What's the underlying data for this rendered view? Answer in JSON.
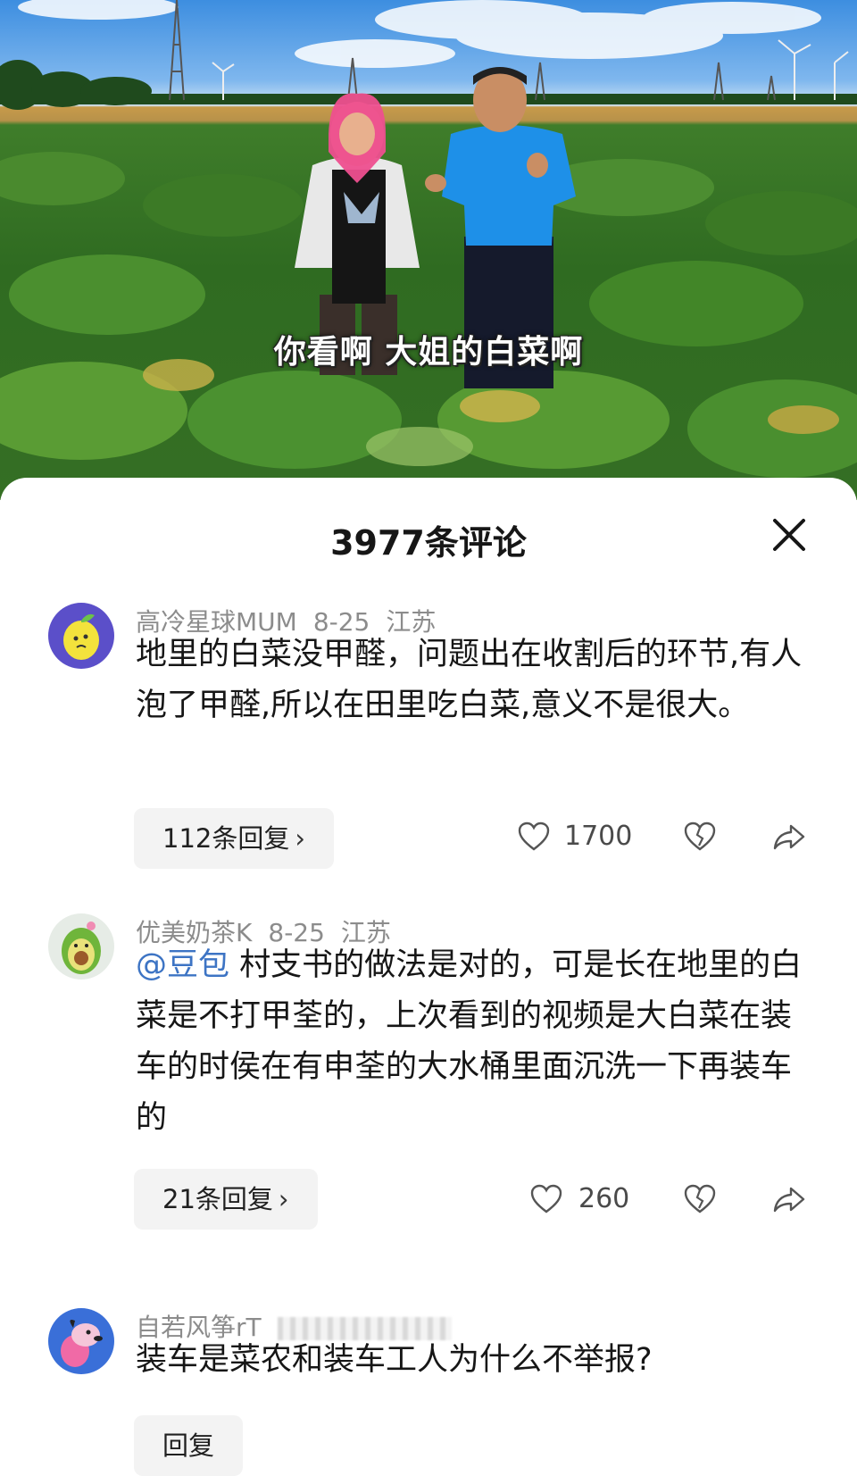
{
  "video": {
    "caption": "你看啊  大姐的白菜啊"
  },
  "comments_panel": {
    "title": "3977条评论",
    "comments": [
      {
        "username": "高冷星球MUM",
        "date": "8-25",
        "location": "江苏",
        "mention": "",
        "text": "地里的白菜没甲醛，问题出在收割后的环节,有人泡了甲醛,所以在田里吃白菜,意义不是很大。",
        "replies_label": "112条回复",
        "likes": "1700",
        "avatar_icon": "lemon-face-icon"
      },
      {
        "username": "优美奶茶K",
        "date": "8-25",
        "location": "江苏",
        "mention": "@豆包",
        "text": " 村支书的做法是对的，可是长在地里的白菜是不打甲荃的，上次看到的视频是大白菜在装车的时侯在有申荃的大水桶里面沉洗一下再装车的",
        "replies_label": "21条回复",
        "likes": "260",
        "avatar_icon": "avocado-icon"
      },
      {
        "username": "自若风筝rT",
        "date": "",
        "location": "",
        "mention": "",
        "text": "装车是菜农和装车工人为什么不举报?",
        "replies_label": "回复",
        "likes": "",
        "avatar_icon": "cartoon-dog-icon"
      }
    ]
  },
  "colors": {
    "mention": "#3d74c4",
    "meta": "#8c8c8c",
    "text": "#161616",
    "reply_bg": "#f3f3f3"
  }
}
